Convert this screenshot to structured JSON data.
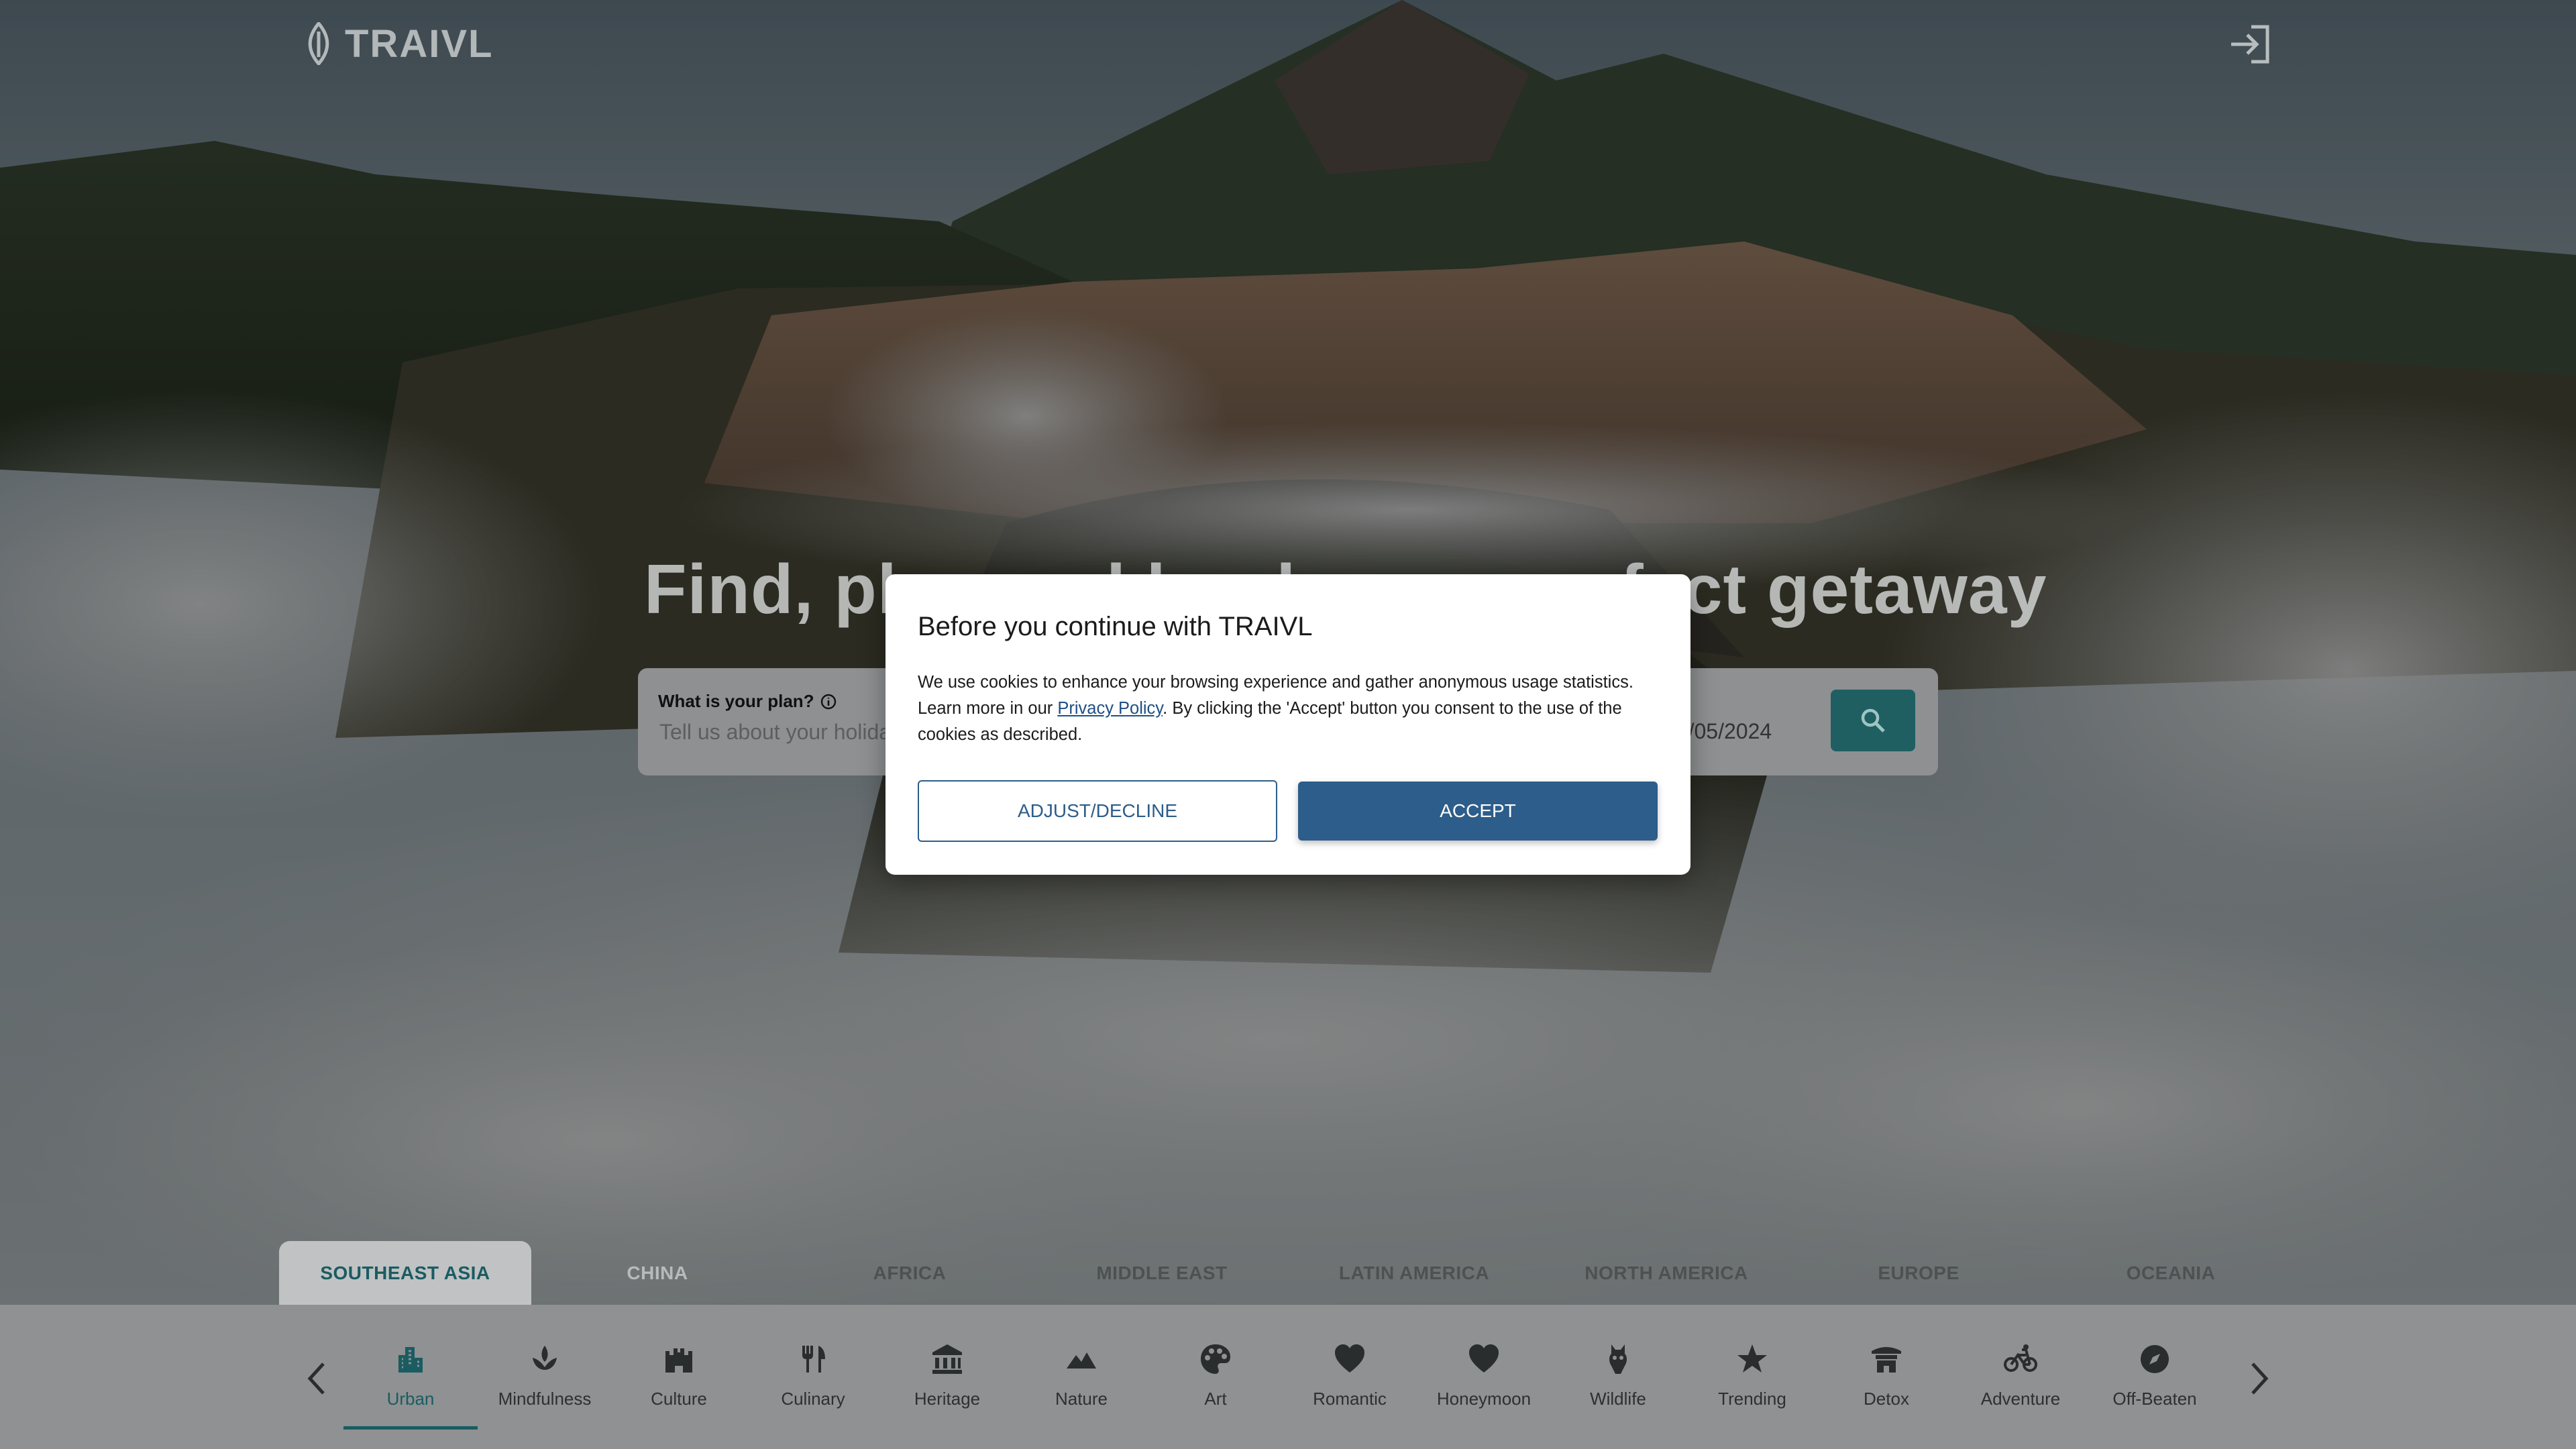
{
  "brand": {
    "name": "TRAIVL"
  },
  "header": {
    "login_icon": "login-icon"
  },
  "hero": {
    "title": "Find, plan and book your perfect getaway"
  },
  "search": {
    "plan_label": "What is your plan?",
    "plan_placeholder": "Tell us about your holiday",
    "date_value": "10/05/2024",
    "search_icon": "search-icon"
  },
  "regions": {
    "tabs": [
      "SOUTHEAST ASIA",
      "CHINA",
      "AFRICA",
      "MIDDLE EAST",
      "LATIN AMERICA",
      "NORTH AMERICA",
      "EUROPE",
      "OCEANIA"
    ],
    "active": "SOUTHEAST ASIA"
  },
  "categories": {
    "items": [
      "Urban",
      "Mindfulness",
      "Culture",
      "Culinary",
      "Heritage",
      "Nature",
      "Art",
      "Romantic",
      "Honeymoon",
      "Wildlife",
      "Trending",
      "Detox",
      "Adventure",
      "Off-Beaten"
    ],
    "icons": [
      "city-icon",
      "lotus-icon",
      "castle-icon",
      "utensils-icon",
      "museum-icon",
      "mountain-icon",
      "palette-icon",
      "heart-icon",
      "heart-icon",
      "animal-icon",
      "star-icon",
      "temple-icon",
      "bicycle-icon",
      "compass-icon"
    ],
    "active": "Urban"
  },
  "cookie_modal": {
    "title": "Before you continue with TRAIVL",
    "body_before_link": "We use cookies to enhance your browsing experience and gather anonymous usage statistics. Learn more in our ",
    "link_text": "Privacy Policy",
    "body_after_link": ". By clicking the 'Accept' button you consent to the use of the cookies as described.",
    "decline_label": "ADJUST/DECLINE",
    "accept_label": "ACCEPT"
  },
  "colors": {
    "accent_teal": "#1a5c62",
    "modal_blue": "#2d5d8a",
    "link_blue": "#1e5085"
  }
}
